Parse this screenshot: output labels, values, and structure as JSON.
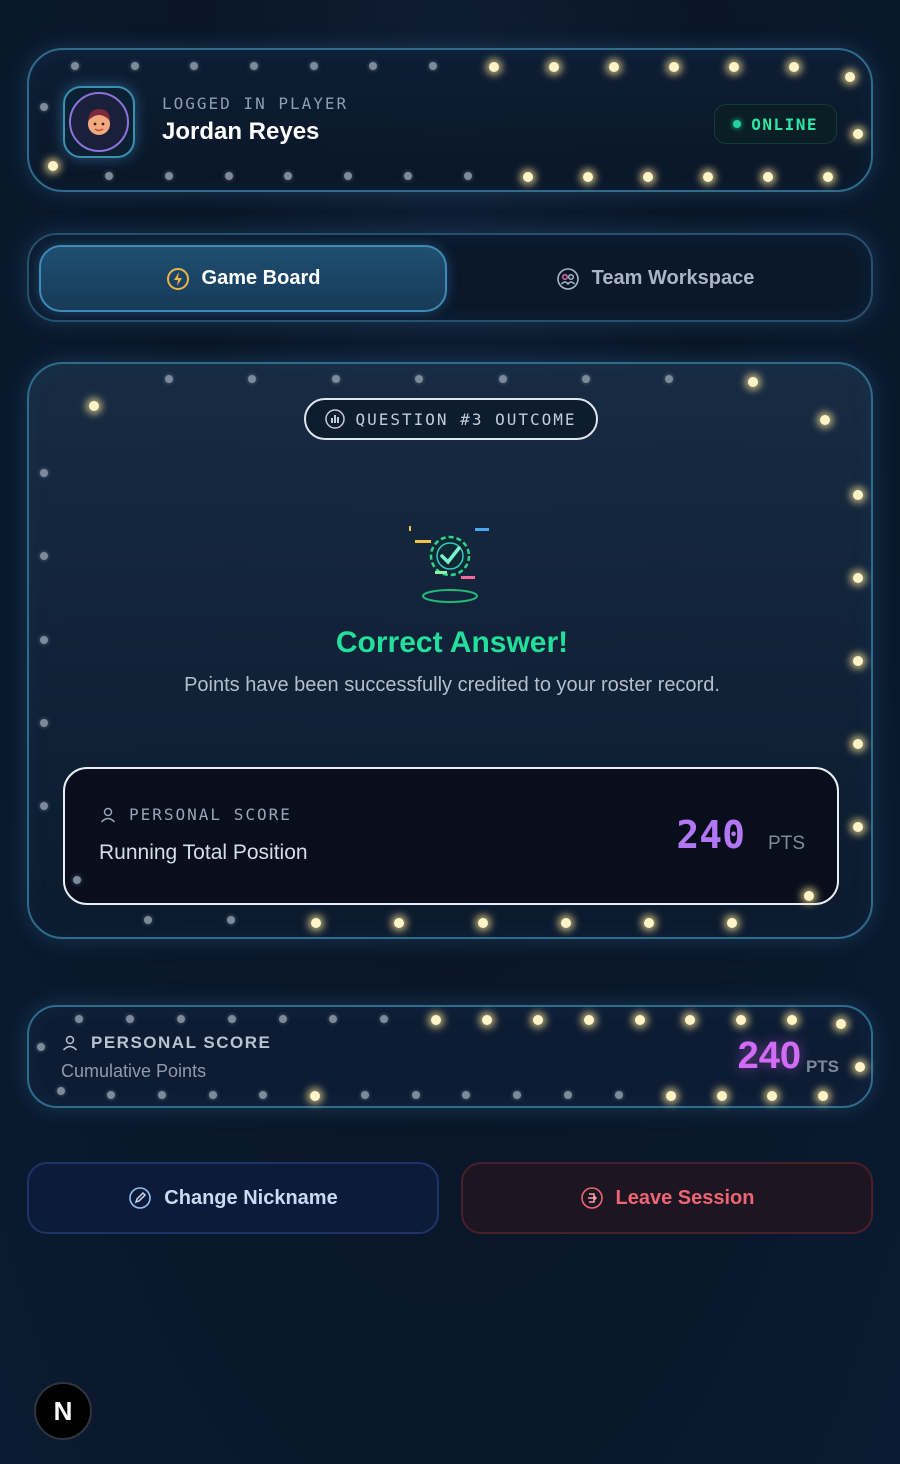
{
  "player": {
    "label": "LOGGED IN PLAYER",
    "name": "Jordan Reyes",
    "status": "ONLINE"
  },
  "tabs": [
    {
      "label": "Game Board",
      "icon": "lightning-icon",
      "active": true
    },
    {
      "label": "Team Workspace",
      "icon": "team-icon",
      "active": false
    }
  ],
  "result": {
    "question_label": "QUESTION #3 OUTCOME",
    "title": "Correct Answer!",
    "subtitle": "Points have been successfully credited to your roster record.",
    "score_label": "PERSONAL SCORE",
    "score_sublabel": "Running Total Position",
    "score_value": "240",
    "score_unit": "PTS"
  },
  "cumulative": {
    "label": "PERSONAL SCORE",
    "sublabel": "Cumulative Points",
    "value": "240",
    "unit": "PTS"
  },
  "actions": {
    "change_nickname": "Change Nickname",
    "leave_session": "Leave Session"
  },
  "badge": {
    "letter": "N"
  },
  "colors": {
    "accent_green": "#22e09c",
    "accent_purple": "#b277f2",
    "accent_magenta": "#d26cf5",
    "danger": "#f06473",
    "frame_border": "#2f6b8c",
    "bulb_glow": "#fff4c8"
  }
}
